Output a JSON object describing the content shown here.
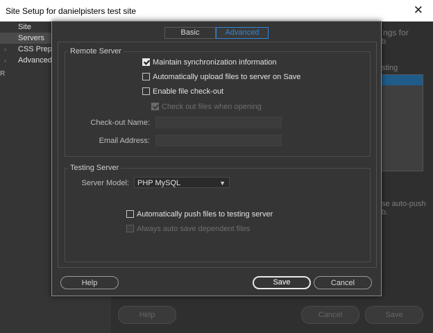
{
  "window": {
    "title": "Site Setup for danielpisters test site",
    "close_glyph": "✕"
  },
  "sidebar": {
    "items": [
      {
        "label": "Site",
        "arrow": ""
      },
      {
        "label": "Servers",
        "arrow": ""
      },
      {
        "label": "CSS Prepro",
        "arrow": "›"
      },
      {
        "label": "Advanced S",
        "arrow": "›"
      }
    ],
    "edge_char": "R"
  },
  "background": {
    "frag_top": "ngs for",
    "frag_b": "b",
    "frag_testing": "sting",
    "frag_auto_push": "se auto-push",
    "frag_b2": "b.",
    "help_label": "Help",
    "cancel_label": "Cancel",
    "save_label": "Save"
  },
  "tabs": {
    "basic": "Basic",
    "advanced": "Advanced"
  },
  "remote_server": {
    "legend": "Remote Server",
    "maintain_sync": {
      "label": "Maintain synchronization information",
      "checked": true
    },
    "auto_upload": {
      "label": "Automatically upload files to server on Save",
      "checked": false
    },
    "enable_checkout": {
      "label": "Enable file check-out",
      "checked": false
    },
    "checkout_when_opening": {
      "label": "Check out files when opening",
      "checked": true,
      "disabled": true
    },
    "checkout_name_label": "Check-out Name:",
    "checkout_name_value": "",
    "email_label": "Email Address:",
    "email_value": ""
  },
  "testing_server": {
    "legend": "Testing Server",
    "server_model_label": "Server Model:",
    "server_model_value": "PHP MySQL",
    "auto_push": {
      "label": "Automatically push files to testing server",
      "checked": false
    },
    "auto_save_dependent": {
      "label": "Always auto save dependent files",
      "checked": false,
      "disabled": true
    }
  },
  "buttons": {
    "help": "Help",
    "save": "Save",
    "cancel": "Cancel"
  }
}
